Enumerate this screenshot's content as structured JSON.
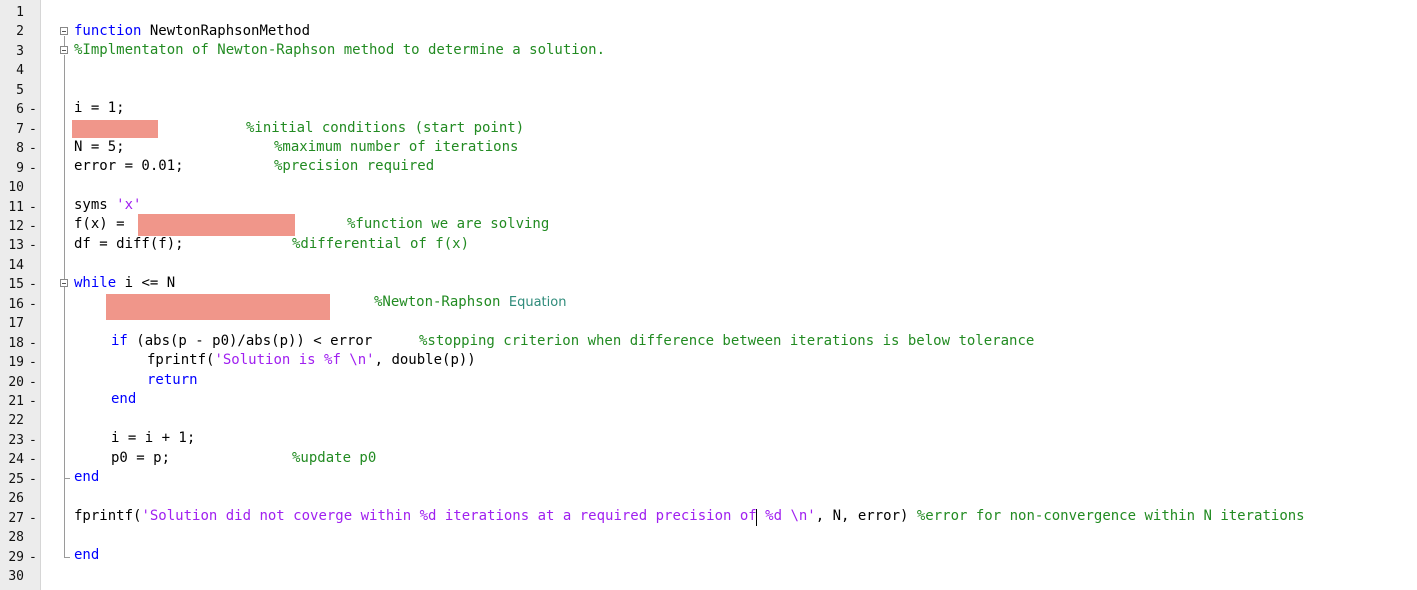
{
  "editor": {
    "lines": [
      {
        "n": "1",
        "dash": false
      },
      {
        "n": "2",
        "dash": false
      },
      {
        "n": "3",
        "dash": false
      },
      {
        "n": "4",
        "dash": false
      },
      {
        "n": "5",
        "dash": false
      },
      {
        "n": "6",
        "dash": true
      },
      {
        "n": "7",
        "dash": true
      },
      {
        "n": "8",
        "dash": true
      },
      {
        "n": "9",
        "dash": true
      },
      {
        "n": "10",
        "dash": false
      },
      {
        "n": "11",
        "dash": true
      },
      {
        "n": "12",
        "dash": true
      },
      {
        "n": "13",
        "dash": true
      },
      {
        "n": "14",
        "dash": false
      },
      {
        "n": "15",
        "dash": true
      },
      {
        "n": "16",
        "dash": true
      },
      {
        "n": "17",
        "dash": false
      },
      {
        "n": "18",
        "dash": true
      },
      {
        "n": "19",
        "dash": true
      },
      {
        "n": "20",
        "dash": true
      },
      {
        "n": "21",
        "dash": true
      },
      {
        "n": "22",
        "dash": false
      },
      {
        "n": "23",
        "dash": true
      },
      {
        "n": "24",
        "dash": true
      },
      {
        "n": "25",
        "dash": true
      },
      {
        "n": "26",
        "dash": false
      },
      {
        "n": "27",
        "dash": true
      },
      {
        "n": "28",
        "dash": false
      },
      {
        "n": "29",
        "dash": true
      },
      {
        "n": "30",
        "dash": false
      }
    ],
    "dash_char": "-",
    "code": {
      "l2_kw": "function",
      "l2_name": " NewtonRaphsonMethod",
      "l3_comment": "%Implmentaton of Newton-Raphson method to determine a solution.",
      "l6": "i = 1;",
      "l7_comment": "%initial conditions (start point)",
      "l8": "N = 5;",
      "l8_comment": "%maximum number of iterations",
      "l9": "error = 0.01;",
      "l9_comment": "%precision required",
      "l11_kw": "syms",
      "l11_str": " 'x'",
      "l12": "f(x) =",
      "l12_comment": "%function we are solving",
      "l13": "df = diff(f);",
      "l13_comment": "%differential of f(x)",
      "l15_kw": "while",
      "l15_rest": " i <= N",
      "l16_comment": "%Newton-Raphson",
      "l16_comment2": "Equation",
      "l18_kw": "if",
      "l18_rest": " (abs(p - p0)/abs(p)) < error",
      "l18_comment": "%stopping criterion when difference between iterations is below tolerance",
      "l19_a": "fprintf(",
      "l19_str": "'Solution is %f \\n'",
      "l19_b": ", double(p))",
      "l20_kw": "return",
      "l21_kw": "end",
      "l23": "i = i + 1;",
      "l24": "p0 = p;",
      "l24_comment": "%update p0",
      "l25_kw": "end",
      "l27_a": "fprintf(",
      "l27_str": "'Solution did not coverge within %d iterations at a required precision of %d \\n'",
      "l27_b": ", N, error)",
      "l27_comment": " %error for non-convergence within N iterations",
      "l29_kw": "end"
    },
    "colors": {
      "keyword": "#0000ff",
      "comment": "#228b22",
      "string": "#a020f0",
      "redaction": "#f0968a"
    }
  }
}
